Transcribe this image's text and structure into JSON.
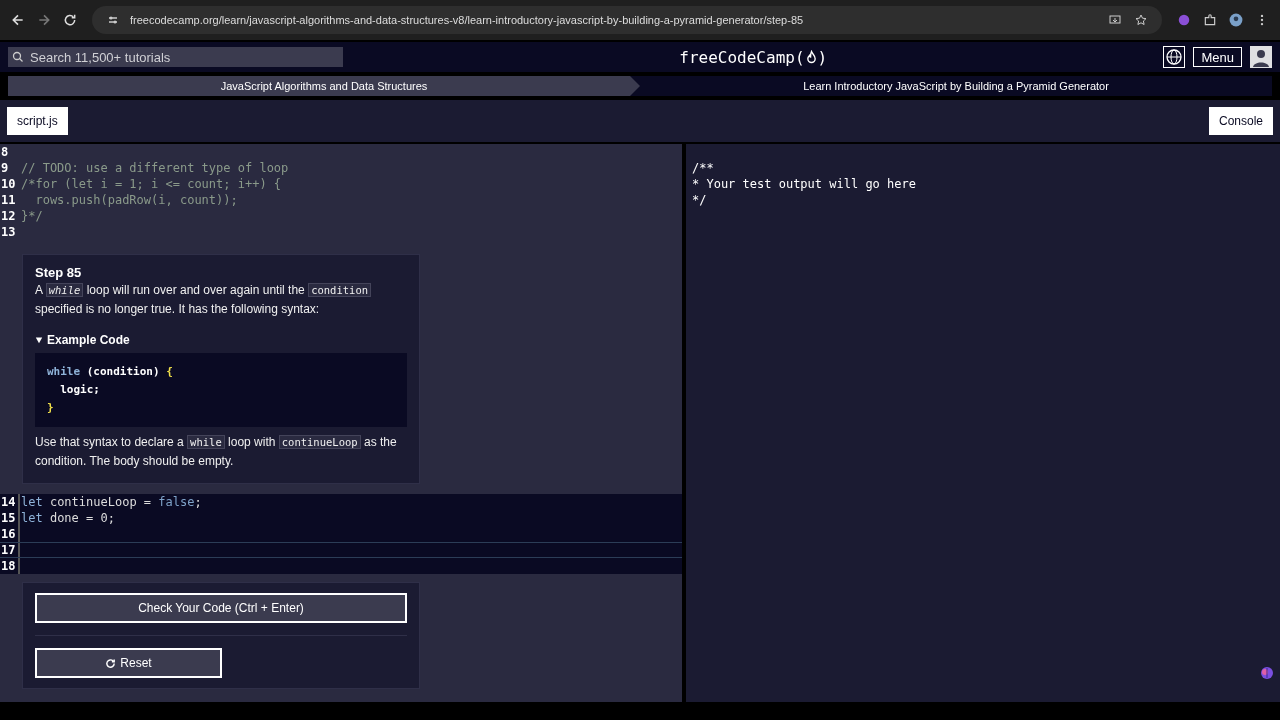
{
  "browser": {
    "url": "freecodecamp.org/learn/javascript-algorithms-and-data-structures-v8/learn-introductory-javascript-by-building-a-pyramid-generator/step-85"
  },
  "navbar": {
    "search_placeholder": "Search 11,500+ tutorials",
    "logo_before": "freeCodeCamp(",
    "logo_after": ")",
    "menu": "Menu"
  },
  "breadcrumbs": [
    {
      "label": "JavaScript Algorithms and Data Structures",
      "selected": true
    },
    {
      "label": "Learn Introductory JavaScript by Building a Pyramid Generator",
      "selected": false
    }
  ],
  "editor_tab": "script.js",
  "console_button": "Console",
  "code_top": [
    {
      "number": "8",
      "active": false
    },
    {
      "number": "9",
      "active": false,
      "tokens": [
        {
          "text": "// TODO: use a different type of loop",
          "kind": "comment"
        }
      ]
    },
    {
      "number": "10",
      "active": false,
      "tokens": [
        {
          "text": "/*for (let i = 1; i <= count; i++) {",
          "kind": "comment"
        }
      ]
    },
    {
      "number": "11",
      "active": false,
      "tokens": [
        {
          "text": "  rows.push(padRow(i, count));",
          "kind": "comment"
        }
      ]
    },
    {
      "number": "12",
      "active": false,
      "tokens": [
        {
          "text": "}*/",
          "kind": "comment"
        }
      ]
    },
    {
      "number": "13",
      "active": false
    }
  ],
  "instructions": {
    "title": "Step 85",
    "paragraphs": [
      [
        {
          "text": "A",
          "kind": "text"
        },
        {
          "text": "while",
          "kind": "code_em"
        },
        {
          "text": "loop will run over and over again until the",
          "kind": "text"
        },
        {
          "text": "condition",
          "kind": "code"
        },
        {
          "text": "specified is no longer true. It has the following syntax:",
          "kind": "text"
        }
      ]
    ],
    "example": {
      "summary": "Example Code",
      "expanded": true,
      "lines": [
        [
          {
            "text": "while",
            "kind": "keyword"
          },
          {
            "text": " (condition) ",
            "kind": "plain"
          },
          {
            "text": "{",
            "kind": "brace"
          }
        ],
        [
          {
            "text": "  logic;",
            "kind": "plain"
          }
        ],
        [
          {
            "text": "}",
            "kind": "brace"
          }
        ]
      ]
    },
    "closing": [
      {
        "text": "Use that syntax to declare a",
        "kind": "text"
      },
      {
        "text": "while",
        "kind": "code"
      },
      {
        "text": "loop with",
        "kind": "text"
      },
      {
        "text": "continueLoop",
        "kind": "code"
      },
      {
        "text": "as the condition. The body should be empty.",
        "kind": "text"
      }
    ]
  },
  "code_bottom": [
    {
      "number": "14",
      "active": false,
      "tokens": [
        {
          "text": "let",
          "kind": "keyword"
        },
        {
          "text": " continueLoop = ",
          "kind": "plain"
        },
        {
          "text": "false",
          "kind": "literal"
        },
        {
          "text": ";",
          "kind": "plain"
        }
      ]
    },
    {
      "number": "15",
      "active": false,
      "tokens": [
        {
          "text": "let",
          "kind": "keyword"
        },
        {
          "text": " done = 0;",
          "kind": "plain"
        }
      ]
    },
    {
      "number": "16",
      "active": false
    },
    {
      "number": "17",
      "active": true
    },
    {
      "number": "18",
      "active": false
    }
  ],
  "buttons": {
    "check": "Check Your Code (Ctrl + Enter)",
    "reset": "Reset"
  },
  "console_output": [
    "/**",
    "* Your test output will go here",
    "*/"
  ]
}
